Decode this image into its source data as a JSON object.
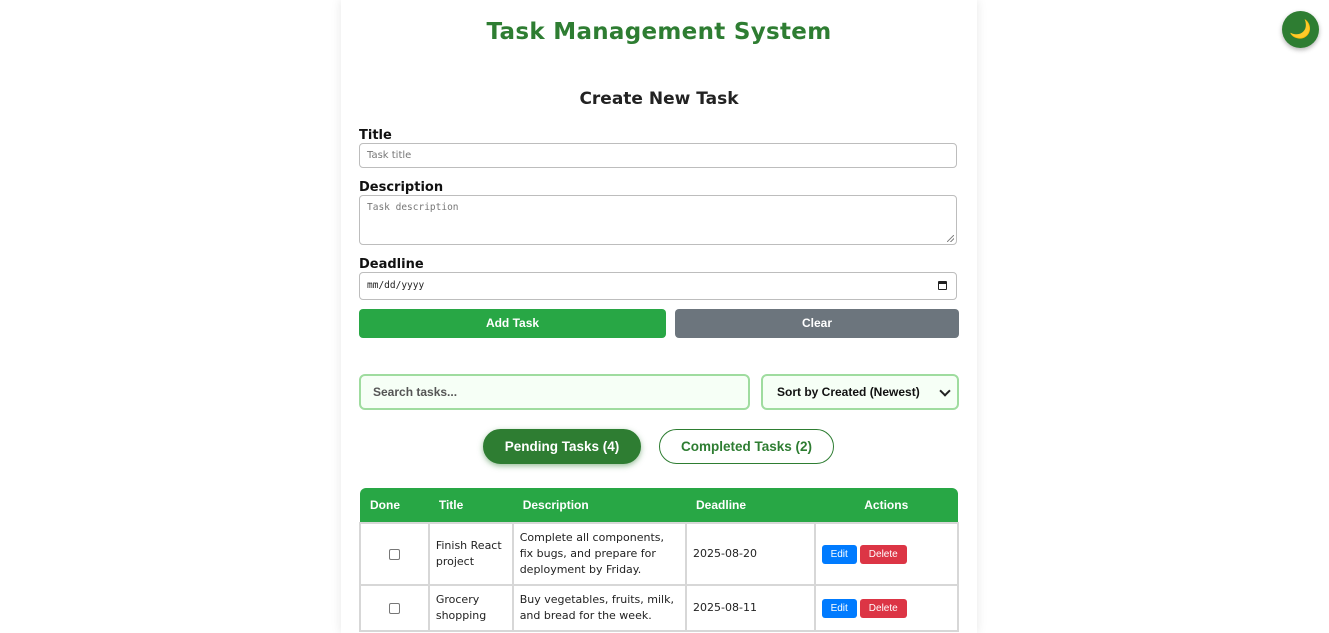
{
  "app": {
    "title": "Task Management System",
    "theme_toggle_icon": "🌙"
  },
  "form": {
    "section_title": "Create New Task",
    "title_label": "Title",
    "title_placeholder": "Task title",
    "description_label": "Description",
    "description_placeholder": "Task description",
    "deadline_label": "Deadline",
    "deadline_placeholder": "mm/dd/yyyy",
    "add_label": "Add Task",
    "clear_label": "Clear"
  },
  "filters": {
    "search_placeholder": "Search tasks...",
    "sort_selected": "Sort by Created (Newest)"
  },
  "tabs": {
    "pending_label": "Pending Tasks (4)",
    "completed_label": "Completed Tasks (2)"
  },
  "table": {
    "headers": [
      "Done",
      "Title",
      "Description",
      "Deadline",
      "Actions"
    ],
    "rows": [
      {
        "title": "Finish React project",
        "description": "Complete all components, fix bugs, and prepare for deployment by Friday.",
        "deadline": "2025-08-20",
        "edit_label": "Edit",
        "delete_label": "Delete"
      },
      {
        "title": "Grocery shopping",
        "description": "Buy vegetables, fruits, milk, and bread for the week.",
        "deadline": "2025-08-11",
        "edit_label": "Edit",
        "delete_label": "Delete"
      }
    ]
  },
  "colors": {
    "primary_green": "#28a745",
    "dark_green": "#2e7d32",
    "gray_button": "#6c757d",
    "edit_blue": "#007bff",
    "delete_red": "#dc3545"
  }
}
